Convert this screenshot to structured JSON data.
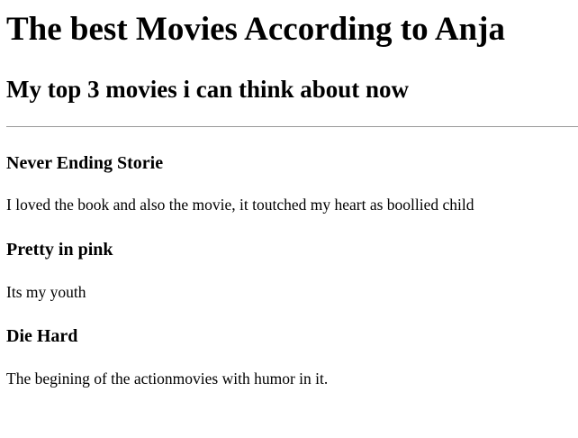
{
  "title": "The best Movies According to Anja",
  "subtitle": "My top 3 movies i can think about now",
  "movies": [
    {
      "name": "Never Ending Storie",
      "comment": "I loved the book and also the movie, it toutched my heart as boollied child"
    },
    {
      "name": "Pretty in pink",
      "comment": "Its my youth"
    },
    {
      "name": "Die Hard",
      "comment": "The begining of the actionmovies with humor in it."
    }
  ]
}
